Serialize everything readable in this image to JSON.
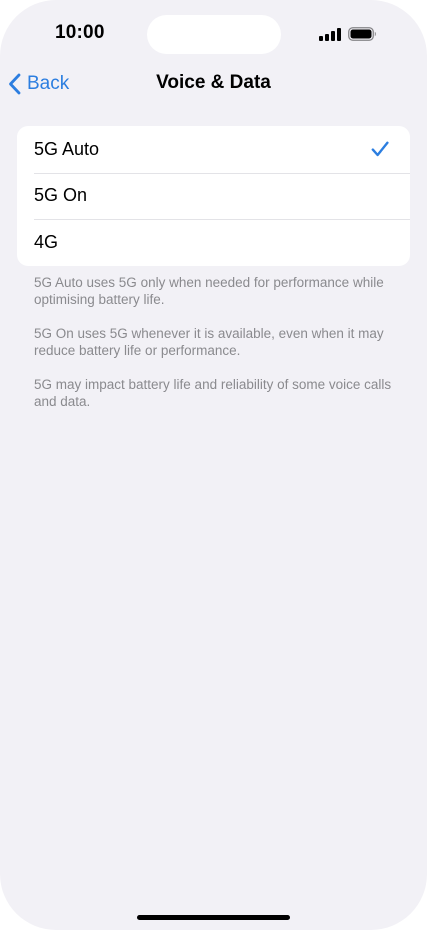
{
  "status_bar": {
    "time": "10:00"
  },
  "nav": {
    "back_label": "Back",
    "title": "Voice & Data",
    "accent_color": "#2c7ee0"
  },
  "options": [
    {
      "label": "5G Auto",
      "selected": true
    },
    {
      "label": "5G On",
      "selected": false
    },
    {
      "label": "4G",
      "selected": false
    }
  ],
  "footnotes": [
    "5G Auto uses 5G only when needed for performance while optimising battery life.",
    "5G On uses 5G whenever it is available, even when it may reduce battery life or performance.",
    "5G may impact battery life and reliability of some voice calls and data."
  ],
  "icons": {
    "back": "chevron-left-icon",
    "selected": "checkmark-icon",
    "signal": "cellular-signal-icon",
    "battery": "battery-icon"
  }
}
